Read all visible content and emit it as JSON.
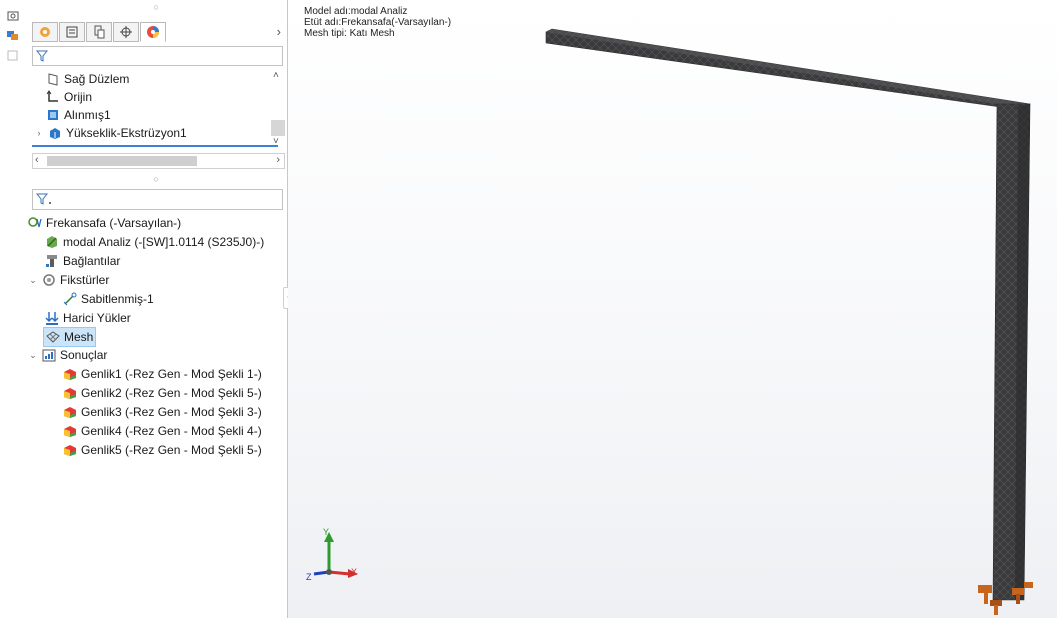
{
  "model_info": {
    "model_name": "Model adı:modal Analiz",
    "study_name": "Etüt adı:Frekansafa(-Varsayılan-)",
    "mesh_type": "Mesh tipi: Katı Mesh"
  },
  "feature_tree": {
    "items": [
      {
        "label": "Sağ Düzlem",
        "icon": "plane-icon"
      },
      {
        "label": "Orijin",
        "icon": "origin-icon"
      },
      {
        "label": "Alınmış1",
        "icon": "imported-body-icon"
      },
      {
        "label": "Yükseklik-Ekstrüzyon1",
        "icon": "extrude-icon"
      }
    ]
  },
  "study_tree": {
    "study": "Frekansafa (-Varsayılan-)",
    "part": "modal Analiz (-[SW]1.0114 (S235J0)-)",
    "connections": "Bağlantılar",
    "fixtures": "Fikstürler",
    "fixed": "Sabitlenmiş-1",
    "external_loads": "Harici Yükler",
    "mesh": "Mesh",
    "results": "Sonuçlar",
    "result_items": [
      "Genlik1 (-Rez Gen - Mod Şekli 1-)",
      "Genlik2 (-Rez Gen - Mod Şekli 5-)",
      "Genlik3 (-Rez Gen - Mod Şekli 3-)",
      "Genlik4 (-Rez Gen - Mod Şekli 4-)",
      "Genlik5 (-Rez Gen - Mod Şekli 5-)"
    ]
  },
  "triad": {
    "x": "X",
    "y": "Y",
    "z": "Z"
  },
  "colors": {
    "accent": "#1f6fc5",
    "selection": "#cce4f7",
    "mesh": "#3a3a3c",
    "fixture": "#c8651c"
  }
}
